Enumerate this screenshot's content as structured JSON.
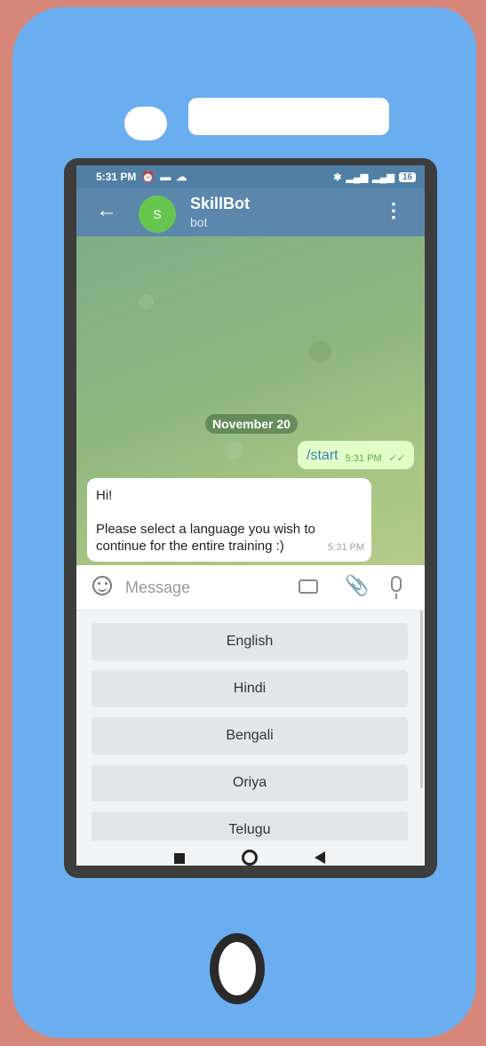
{
  "status_bar": {
    "time": "5:31 PM",
    "battery": "16"
  },
  "header": {
    "avatar_letter": "S",
    "title": "SkillBot",
    "subtitle": "bot"
  },
  "chat": {
    "date_chip": "November 20",
    "outgoing": {
      "text": "/start",
      "time": "5:31 PM"
    },
    "incoming": {
      "line1": "Hi!",
      "line2": "Please select a language you wish to continue for the entire training :)",
      "time": "5:31 PM"
    }
  },
  "input": {
    "placeholder": "Message"
  },
  "reply_keyboard": [
    "English",
    "Hindi",
    "Bengali",
    "Oriya",
    "Telugu"
  ]
}
